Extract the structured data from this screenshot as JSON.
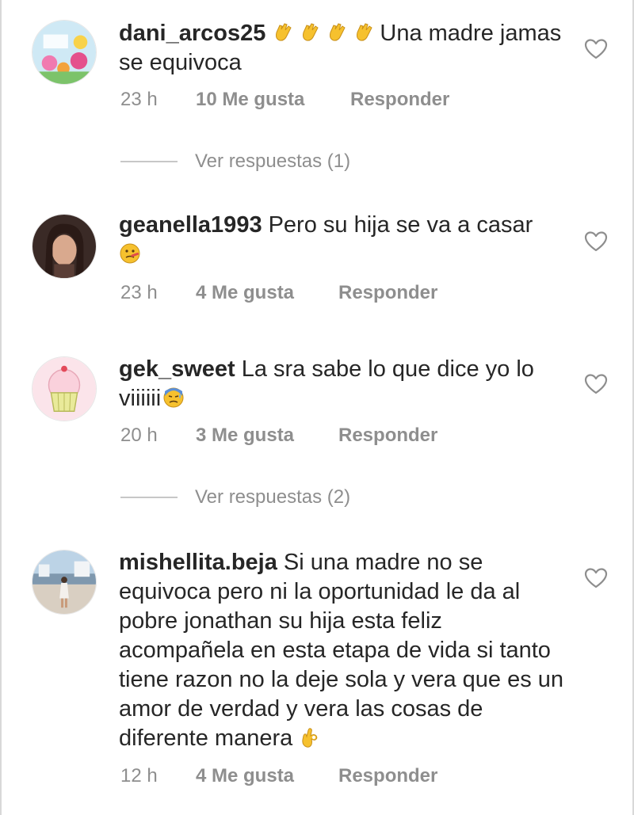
{
  "comments": [
    {
      "username": "dani_arcos25",
      "text": "Una madre jamas se equivoca",
      "emoji_prefix": [
        "clapping-hands",
        "clapping-hands",
        "clapping-hands",
        "clapping-hands"
      ],
      "time": "23 h",
      "likes": "10 Me gusta",
      "reply": "Responder",
      "avatar": "floral-illustration-avatar"
    },
    {
      "username": "geanella1993",
      "text": "Pero su hija se va a casar",
      "emoji_suffix": "face-with-thermometer",
      "time": "23 h",
      "likes": "4 Me gusta",
      "reply": "Responder",
      "avatar": "portrait-photo-avatar"
    },
    {
      "username": "gek_sweet",
      "text": "La sra sabe lo que dice yo lo viiiiii",
      "emoji_suffix": "downcast-face-with-sweat",
      "time": "20 h",
      "likes": "3 Me gusta",
      "reply": "Responder",
      "avatar": "cupcake-avatar"
    },
    {
      "username": "mishellita.beja",
      "text": "Si una madre no se equivoca pero ni la oportunidad le da al pobre jonathan su hija esta feliz acompañela en esta etapa de vida si tanto tiene razon no la deje sola y vera que es un amor de verdad y vera las cosas de diferente manera",
      "emoji_suffix": "ok-hand",
      "time": "12 h",
      "likes": "4 Me gusta",
      "reply": "Responder",
      "avatar": "beach-photo-avatar"
    }
  ],
  "view_replies": [
    {
      "label": "Ver respuestas (1)"
    },
    {
      "label": "Ver respuestas (2)"
    }
  ],
  "colors": {
    "text": "#262626",
    "meta": "#8e8e8e",
    "divider": "#c7c7c7",
    "emoji_yellow": "#f6c12e"
  },
  "icons": {
    "like": "heart-outline-icon"
  }
}
